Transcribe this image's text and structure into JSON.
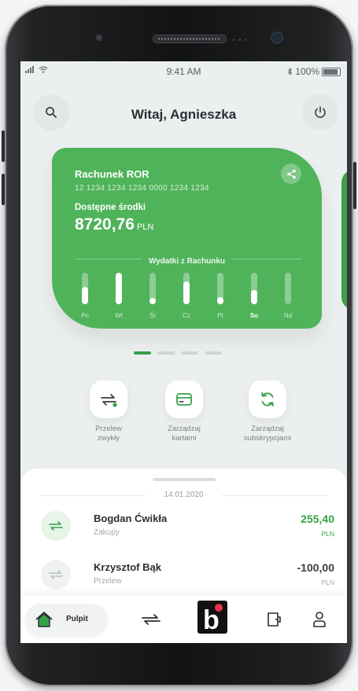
{
  "status_bar": {
    "time": "9:41 AM",
    "battery": "100%"
  },
  "header": {
    "greeting": "Witaj, Agnieszka",
    "icons": [
      "search-icon",
      "power-icon"
    ]
  },
  "account_card": {
    "title": "Rachunek ROR",
    "number": "12 1234 1234 1234 0000 1234 1234",
    "available_label": "Dostępne środki",
    "balance": "8720,76",
    "currency": "PLN",
    "expenses_label": "Wydatki z Rachunku",
    "accent": "#4fb35a",
    "days": [
      {
        "label": "Pn",
        "level": 0.55,
        "bold": false
      },
      {
        "label": "Wt",
        "level": 1.0,
        "bold": false
      },
      {
        "label": "Śr",
        "level": 0.18,
        "bold": false
      },
      {
        "label": "Cz",
        "level": 0.72,
        "bold": false
      },
      {
        "label": "Pt",
        "level": 0.22,
        "bold": false
      },
      {
        "label": "So",
        "level": 0.45,
        "bold": true
      },
      {
        "label": "Nd",
        "level": 0.0,
        "bold": false
      }
    ]
  },
  "pager": {
    "count": 4,
    "active": 0
  },
  "quick_actions": [
    {
      "line1": "Przelew",
      "line2": "zwykły",
      "icon": "transfer-icon"
    },
    {
      "line1": "Zarządzaj",
      "line2": "kartami",
      "icon": "card-icon"
    },
    {
      "line1": "Zarządzaj",
      "line2": "subskrypcjami",
      "icon": "refresh-icon"
    }
  ],
  "transactions": {
    "date": "14.01.2020",
    "items": [
      {
        "name": "Bogdan Ćwikła",
        "category": "Zakupy",
        "amount": "255,40",
        "currency": "PLN",
        "color": "#37a048"
      },
      {
        "name": "Krzysztof Bąk",
        "category": "Przelew",
        "amount": "-100,00",
        "currency": "PLN",
        "color": "#3a3d41"
      }
    ]
  },
  "bottom_nav": {
    "home_label": "Pulpit",
    "brand_letter": "b",
    "brand_dot_color": "#e8344a",
    "icons": [
      "home-icon",
      "transfer-icon",
      "brand-icon",
      "wallet-icon",
      "profile-icon"
    ]
  }
}
